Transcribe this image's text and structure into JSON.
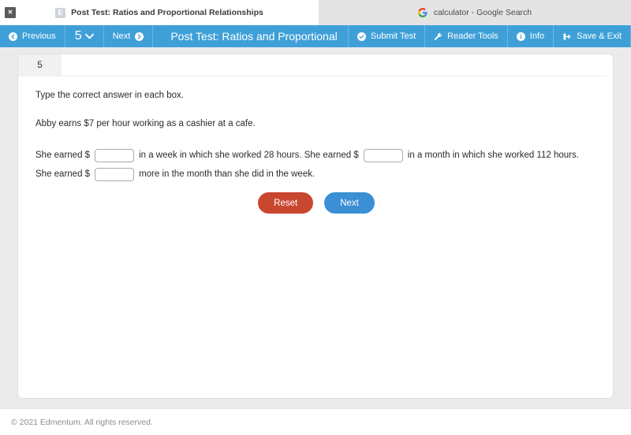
{
  "browser": {
    "tabs": [
      {
        "title": "Post Test: Ratios and Proportional Relationships",
        "favicon": "edmentum-icon",
        "favicon_letter": "E",
        "active": true,
        "close_label": "✕"
      },
      {
        "title": "calculator - Google Search",
        "favicon": "google-icon",
        "active": false
      }
    ]
  },
  "toolbar": {
    "previous_label": "Previous",
    "page_number": "5",
    "next_label": "Next",
    "test_title": "Post Test: Ratios and Proportional Re",
    "submit_label": "Submit Test",
    "reader_tools_label": "Reader Tools",
    "info_label": "Info",
    "save_exit_label": "Save & Exit",
    "accent_color": "#3fa0d8"
  },
  "question": {
    "number": "5",
    "instruction": "Type the correct answer in each box.",
    "context": "Abby earns $7 per hour working as a cashier at a cafe.",
    "segments": [
      {
        "type": "text",
        "value": "She earned $"
      },
      {
        "type": "input",
        "value": "",
        "placeholder": ""
      },
      {
        "type": "text",
        "value": "in a week in which she worked 28 hours. She earned $"
      },
      {
        "type": "input",
        "value": "",
        "placeholder": ""
      },
      {
        "type": "text",
        "value": "in a month in which she worked 112 hours. She earned $"
      },
      {
        "type": "input",
        "value": "",
        "placeholder": ""
      },
      {
        "type": "text",
        "value": "more in the month than she did in the week."
      }
    ]
  },
  "actions": {
    "reset_label": "Reset",
    "reset_color": "#c9462f",
    "next_label": "Next",
    "next_color": "#3b8fd4"
  },
  "footer": {
    "copyright": "© 2021 Edmentum. All rights reserved."
  }
}
